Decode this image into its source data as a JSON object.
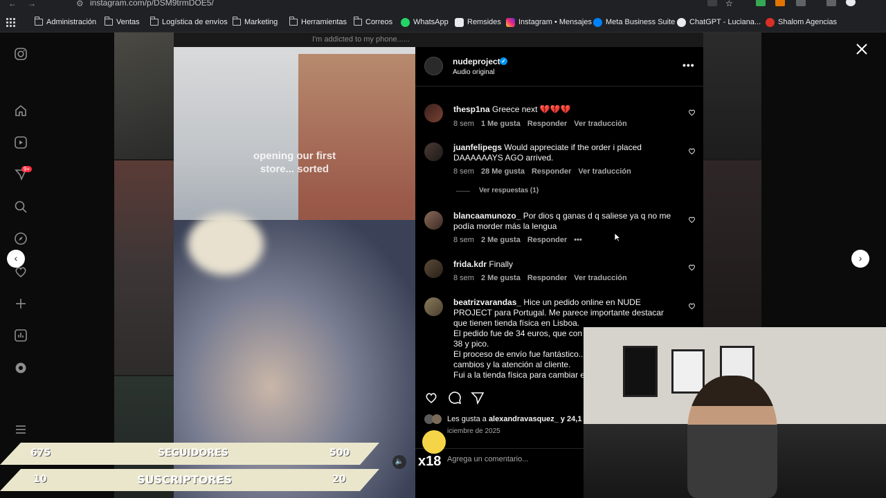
{
  "browser": {
    "url": "instagram.com/p/DSM9trmDOE5/",
    "bookmarks": [
      {
        "label": "Administración",
        "icon": "folder-icon"
      },
      {
        "label": "Ventas",
        "icon": "folder-icon"
      },
      {
        "label": "Logística de envíos",
        "icon": "folder-icon"
      },
      {
        "label": "Marketing",
        "icon": "folder-icon"
      },
      {
        "label": "Herramientas",
        "icon": "folder-icon"
      },
      {
        "label": "Correos",
        "icon": "folder-icon"
      },
      {
        "label": "WhatsApp",
        "icon": "whatsapp-icon"
      },
      {
        "label": "Remsides",
        "icon": "remsides-icon"
      },
      {
        "label": "Instagram • Mensajes",
        "icon": "instagram-icon"
      },
      {
        "label": "Meta Business Suite",
        "icon": "meta-icon"
      },
      {
        "label": "ChatGPT - Luciana...",
        "icon": "chatgpt-icon"
      },
      {
        "label": "Shalom Agencias",
        "icon": "shalom-icon"
      }
    ]
  },
  "sidebar": {
    "notification_badge": "9+",
    "icons": [
      "instagram-icon",
      "home-icon",
      "reels-icon",
      "messages-icon",
      "search-icon",
      "explore-icon",
      "notifications-icon",
      "create-icon",
      "dashboard-icon",
      "threads-icon",
      "menu-icon"
    ]
  },
  "background": {
    "caption": "I'm addicted to my phone......"
  },
  "video": {
    "overlay_text": "opening our first store... sorted",
    "mute_icon": "volume-icon"
  },
  "post": {
    "username": "nudeproject",
    "verified": true,
    "audio": "Audio original",
    "likes_text_prefix": "Les gusta a ",
    "likes_user": "alexandravasquez_",
    "likes_text_suffix": " y 24,1",
    "date": "iciembre de 2025",
    "comment_placeholder": "Agrega un comentario..."
  },
  "comments": [
    {
      "user": "thesp1na",
      "text": "Greece next 💔💔💔",
      "age": "8 sem",
      "likes": "1 Me gusta",
      "reply": "Responder",
      "translate": "Ver traducción"
    },
    {
      "user": "juanfelipegs",
      "text": "Would appreciate if the order i placed DAAAAAAYS AGO arrived.",
      "age": "8 sem",
      "likes": "28 Me gusta",
      "reply": "Responder",
      "translate": "Ver traducción",
      "replies": "Ver respuestas (1)"
    },
    {
      "user": "blancaamunozo_",
      "text": "Por dios q ganas d q saliese ya q no me podía morder más la lengua",
      "age": "8 sem",
      "likes": "2 Me gusta",
      "reply": "Responder",
      "more": "•••"
    },
    {
      "user": "frida.kdr",
      "text": "Finally",
      "age": "8 sem",
      "likes": "2 Me gusta",
      "reply": "Responder",
      "translate": "Ver traducción"
    },
    {
      "user": "beatrizvarandas_",
      "text": "Hice un pedido online en NUDE PROJECT para Portugal. Me parece importante destacar que tienen tienda física en Lisboa.",
      "extra": [
        "El pedido fue de 34 euros, que con lo",
        "38 y pico.",
        "El proceso de envío fue fantástico... l",
        "cambios y la atención al cliente.",
        "Fui a la tienda física para cambiar el"
      ]
    }
  ],
  "stream_overlay": {
    "bar1": {
      "left": "675",
      "label": "SEGUIDORES",
      "right": "500"
    },
    "bar2": {
      "left": "10",
      "label": "SUSCRIPTORES",
      "right": "20"
    },
    "emote_text": "x18"
  },
  "colors": {
    "accent_blue": "#0095f6",
    "bar_fill": "#e9e6cc"
  }
}
